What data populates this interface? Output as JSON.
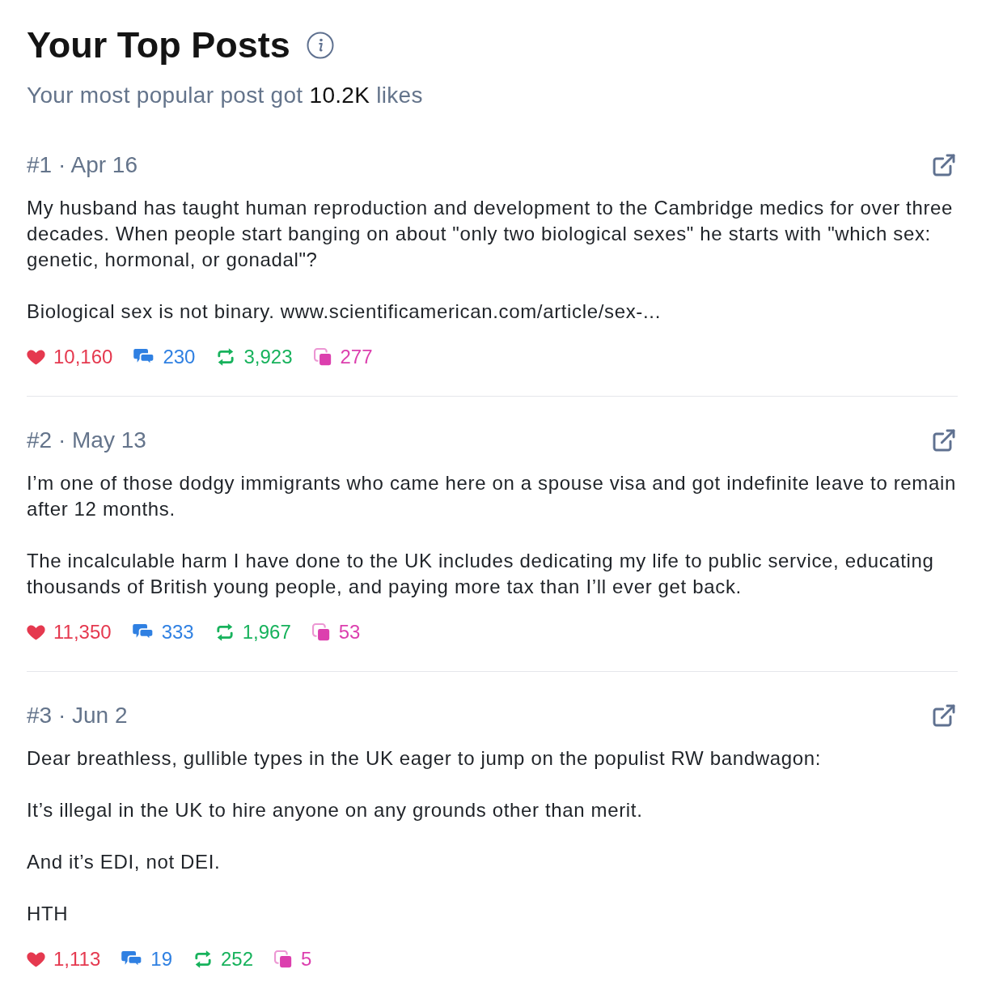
{
  "header": {
    "title": "Your Top Posts",
    "subtitle": {
      "before": "Your most popular post got",
      "highlight": "10.2K",
      "after": "likes"
    }
  },
  "posts": [
    {
      "label": "#1 · Apr 16",
      "paragraphs": [
        "My husband has taught human reproduction and development to the Cambridge medics for over three decades. When people start banging on about \"only two biological sexes\" he starts with \"which sex: genetic, hormonal, or gonadal\"?",
        "Biological sex is not binary. www.scientificamerican.com/article/sex-..."
      ],
      "stats": [
        {
          "kind": "likes",
          "value": "10,160",
          "color": "#e5394f"
        },
        {
          "kind": "replies",
          "value": "230",
          "color": "#2f80e2"
        },
        {
          "kind": "reposts",
          "value": "3,923",
          "color": "#17b25c"
        },
        {
          "kind": "quotes",
          "value": "277",
          "color": "#dc3fae"
        }
      ]
    },
    {
      "label": "#2 · May 13",
      "paragraphs": [
        "I’m one of those dodgy immigrants who came here on a spouse visa and got indefinite leave to remain after 12 months.",
        "The incalculable harm I have done to the UK includes dedicating my life to public service, educating thousands of British young people, and paying more tax than I’ll ever get back."
      ],
      "stats": [
        {
          "kind": "likes",
          "value": "11,350",
          "color": "#e5394f"
        },
        {
          "kind": "replies",
          "value": "333",
          "color": "#2f80e2"
        },
        {
          "kind": "reposts",
          "value": "1,967",
          "color": "#17b25c"
        },
        {
          "kind": "quotes",
          "value": "53",
          "color": "#dc3fae"
        }
      ]
    },
    {
      "label": "#3 · Jun 2",
      "paragraphs": [
        "Dear breathless, gullible types in the UK eager to jump on the populist RW bandwagon:",
        "It’s illegal in the UK to hire anyone on any grounds other than merit.",
        "And it’s EDI, not DEI.",
        "HTH"
      ],
      "stats": [
        {
          "kind": "likes",
          "value": "1,113",
          "color": "#e5394f"
        },
        {
          "kind": "replies",
          "value": "19",
          "color": "#2f80e2"
        },
        {
          "kind": "reposts",
          "value": "252",
          "color": "#17b25c"
        },
        {
          "kind": "quotes",
          "value": "5",
          "color": "#dc3fae"
        }
      ]
    }
  ]
}
